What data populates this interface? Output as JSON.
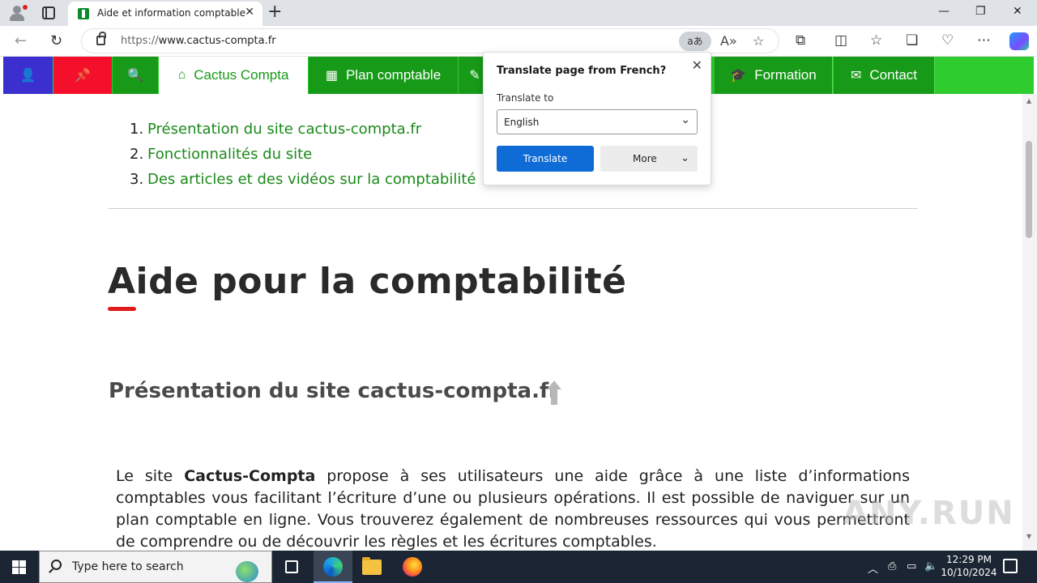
{
  "browser": {
    "tab_title": "Aide et information comptable",
    "tab_close": "✕",
    "new_tab": "+",
    "url_prefix": "https://",
    "url_host": "www.cactus-compta.fr",
    "translate_pill": "aあ",
    "window_controls": {
      "minimize": "—",
      "restore": "❐",
      "close": "✕"
    }
  },
  "site_nav": {
    "home_label": "Cactus Compta",
    "plan_label": "Plan comptable",
    "formation_label": "Formation",
    "contact_label": "Contact"
  },
  "translate_popup": {
    "title": "Translate page from French?",
    "translate_to_label": "Translate to",
    "selected_language": "English",
    "translate_button": "Translate",
    "more_button": "More",
    "close": "✕"
  },
  "content": {
    "toc": [
      {
        "num": "1.",
        "label": "Présentation du site cactus-compta.fr"
      },
      {
        "num": "2.",
        "label": "Fonctionnalités du site"
      },
      {
        "num": "3.",
        "label": "Des articles et des vidéos sur la comptabilité"
      }
    ],
    "h1": "Aide pour la comptabilité",
    "h2": "Présentation du site cactus-compta.fr",
    "para_before": "Le site ",
    "para_bold": "Cactus-Compta",
    "para_after": " propose à ses utilisateurs une aide grâce à une liste d’informations comptables vous facilitant l’écriture d’une ou plusieurs opérations. Il est possible de naviguer sur un plan comptable en ligne. Vous trouverez également de nombreuses ressources qui vous permettront de comprendre ou de découvrir les règles et les écritures comptables."
  },
  "watermark": "ANY.RUN",
  "taskbar": {
    "search_placeholder": "Type here to search",
    "time": "12:29 PM",
    "date": "10/10/2024"
  },
  "colors": {
    "nav_green": "#179a17",
    "nav_bright_green": "#2ecc2e",
    "nav_blue": "#3b2fcf",
    "nav_red": "#f4102a",
    "link_green": "#1a8a1a",
    "accent_red": "#e21b1b",
    "translate_blue": "#0f6cd6"
  }
}
